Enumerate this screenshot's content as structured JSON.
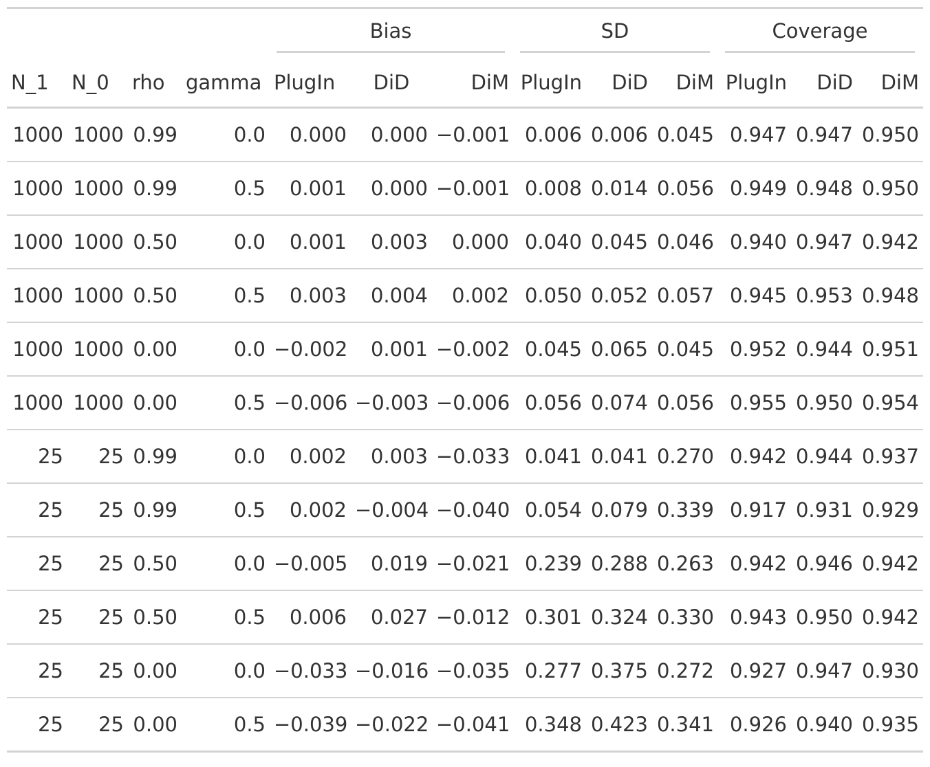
{
  "table": {
    "spanners": [
      "",
      "Bias",
      "SD",
      "Coverage"
    ],
    "columns": [
      "N_1",
      "N_0",
      "rho",
      "gamma",
      "PlugIn",
      "DiD",
      "DiM",
      "PlugIn",
      "DiD",
      "DiM",
      "PlugIn",
      "DiD",
      "DiM"
    ],
    "rows": [
      [
        "1000",
        "1000",
        "0.99",
        "0.0",
        "0.000",
        "0.000",
        "−0.001",
        "0.006",
        "0.006",
        "0.045",
        "0.947",
        "0.947",
        "0.950"
      ],
      [
        "1000",
        "1000",
        "0.99",
        "0.5",
        "0.001",
        "0.000",
        "−0.001",
        "0.008",
        "0.014",
        "0.056",
        "0.949",
        "0.948",
        "0.950"
      ],
      [
        "1000",
        "1000",
        "0.50",
        "0.0",
        "0.001",
        "0.003",
        "0.000",
        "0.040",
        "0.045",
        "0.046",
        "0.940",
        "0.947",
        "0.942"
      ],
      [
        "1000",
        "1000",
        "0.50",
        "0.5",
        "0.003",
        "0.004",
        "0.002",
        "0.050",
        "0.052",
        "0.057",
        "0.945",
        "0.953",
        "0.948"
      ],
      [
        "1000",
        "1000",
        "0.00",
        "0.0",
        "−0.002",
        "0.001",
        "−0.002",
        "0.045",
        "0.065",
        "0.045",
        "0.952",
        "0.944",
        "0.951"
      ],
      [
        "1000",
        "1000",
        "0.00",
        "0.5",
        "−0.006",
        "−0.003",
        "−0.006",
        "0.056",
        "0.074",
        "0.056",
        "0.955",
        "0.950",
        "0.954"
      ],
      [
        "25",
        "25",
        "0.99",
        "0.0",
        "0.002",
        "0.003",
        "−0.033",
        "0.041",
        "0.041",
        "0.270",
        "0.942",
        "0.944",
        "0.937"
      ],
      [
        "25",
        "25",
        "0.99",
        "0.5",
        "0.002",
        "−0.004",
        "−0.040",
        "0.054",
        "0.079",
        "0.339",
        "0.917",
        "0.931",
        "0.929"
      ],
      [
        "25",
        "25",
        "0.50",
        "0.0",
        "−0.005",
        "0.019",
        "−0.021",
        "0.239",
        "0.288",
        "0.263",
        "0.942",
        "0.946",
        "0.942"
      ],
      [
        "25",
        "25",
        "0.50",
        "0.5",
        "0.006",
        "0.027",
        "−0.012",
        "0.301",
        "0.324",
        "0.330",
        "0.943",
        "0.950",
        "0.942"
      ],
      [
        "25",
        "25",
        "0.00",
        "0.0",
        "−0.033",
        "−0.016",
        "−0.035",
        "0.277",
        "0.375",
        "0.272",
        "0.927",
        "0.947",
        "0.930"
      ],
      [
        "25",
        "25",
        "0.00",
        "0.5",
        "−0.039",
        "−0.022",
        "−0.041",
        "0.348",
        "0.423",
        "0.341",
        "0.926",
        "0.940",
        "0.935"
      ]
    ]
  }
}
